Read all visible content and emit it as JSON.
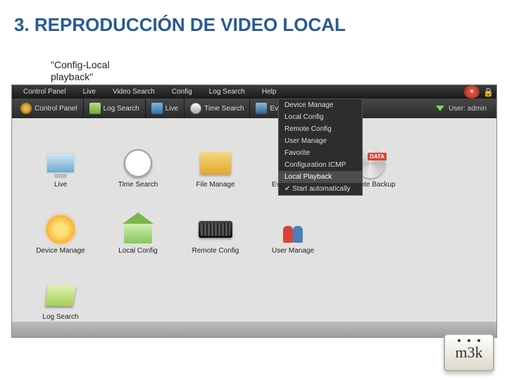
{
  "slide": {
    "title": "3. REPRODUCCIÓN DE VIDEO LOCAL"
  },
  "callout": {
    "text": "\"Config-Local playback\""
  },
  "topbar": {
    "items": [
      "Control Panel",
      "Live",
      "Video Search",
      "Config",
      "Log Search",
      "Help"
    ]
  },
  "toolbar": {
    "items": [
      {
        "label": "Control Panel"
      },
      {
        "label": "Log Search"
      },
      {
        "label": "Live"
      },
      {
        "label": "Time Search"
      },
      {
        "label": "Event Search"
      }
    ],
    "user_label": "User: admin"
  },
  "config_menu": {
    "items": [
      {
        "label": "Device Manage",
        "highlight": false
      },
      {
        "label": "Local Config",
        "highlight": false
      },
      {
        "label": "Remote Config",
        "highlight": false
      },
      {
        "label": "User Manage",
        "highlight": false
      },
      {
        "label": "Favorite",
        "highlight": false
      },
      {
        "label": "Configuration ICMP",
        "highlight": false
      },
      {
        "label": "Local Playback",
        "highlight": true
      },
      {
        "label": "Start automatically",
        "highlight": false,
        "checked": true
      }
    ]
  },
  "launchers": {
    "row1": [
      "Live",
      "Time Search",
      "File Manage",
      "Event Search",
      "Remote Backup"
    ],
    "row2": [
      "Device Manage",
      "Local Config",
      "Remote Config",
      "User Manage"
    ],
    "row3": [
      "Log Search"
    ]
  },
  "disc_badge": "DATA",
  "logo": {
    "text": "m3k"
  }
}
